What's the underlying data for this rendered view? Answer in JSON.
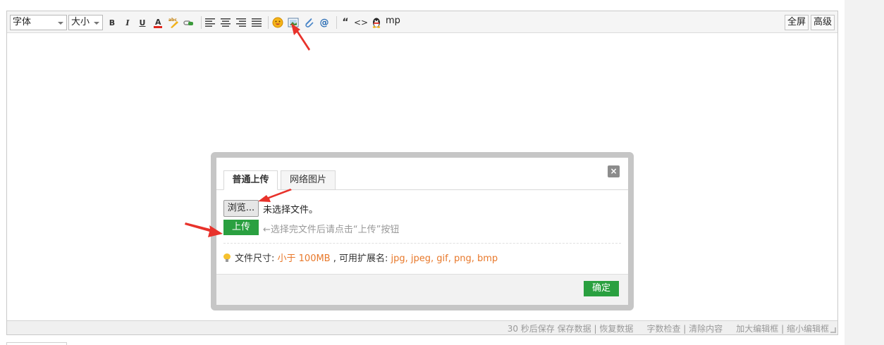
{
  "toolbar": {
    "font_label": "字体",
    "size_label": "大小",
    "bold": "B",
    "italic": "I",
    "underline": "U",
    "mp_label": "mp",
    "fullscreen_label": "全屏",
    "advanced_label": "高级"
  },
  "dialog": {
    "tab_upload": "普通上传",
    "tab_network": "网络图片",
    "close_glyph": "×",
    "browse_label": "浏览...",
    "no_file_text": "未选择文件。",
    "upload_label": "上传",
    "upload_hint": "←选择完文件后请点击“上传”按钮",
    "size_label": "文件尺寸: ",
    "size_value": "小于 100MB",
    "ext_label": " , 可用扩展名: ",
    "ext_value": "jpg, jpeg, gif, png, bmp",
    "ok_label": "确定"
  },
  "status_bar": {
    "autosave": "30 秒后保存",
    "save_data": "保存数据",
    "restore_data": "恢复数据",
    "word_check": "字数检查",
    "clear_content": "清除内容",
    "enlarge": "加大编辑框",
    "shrink": "缩小编辑框"
  },
  "colors": {
    "accent_green": "#2aa040",
    "highlight_orange": "#e8782a",
    "annotation_red": "#e8322b"
  }
}
